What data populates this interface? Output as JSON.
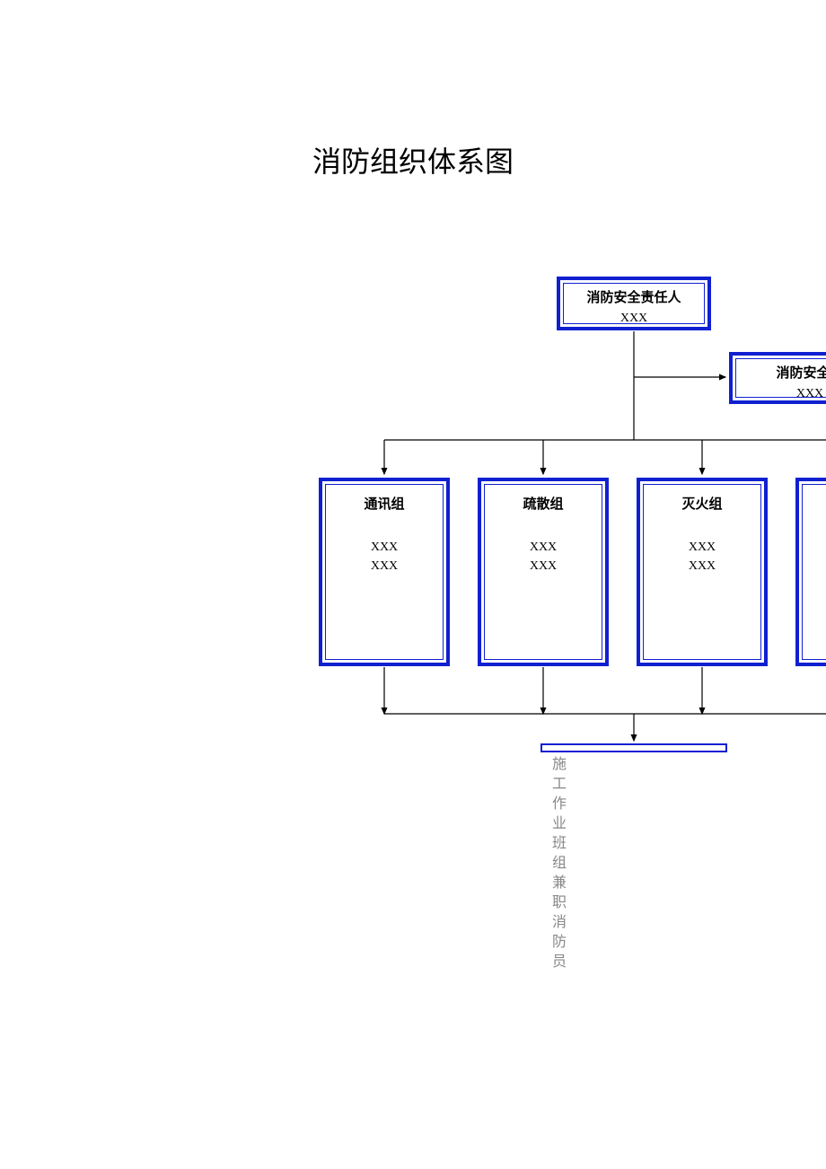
{
  "title": "消防组织体系图",
  "top_box": {
    "label": "消防安全责任人",
    "name": "XXX"
  },
  "manager_box": {
    "label": "消防安全管",
    "name": "XXX"
  },
  "groups": [
    {
      "title": "通讯组",
      "line1": "XXX",
      "line2": "XXX"
    },
    {
      "title": "疏散组",
      "line1": "XXX",
      "line2": "XXX"
    },
    {
      "title": "灭火组",
      "line1": "XXX",
      "line2": "XXX"
    }
  ],
  "bottom_text": "施工作业班组兼职消防员",
  "diagram": {
    "type": "org-chart",
    "description": "Fire protection organization hierarchy",
    "root": "消防安全责任人 XXX",
    "manager_branch": "消防安全管 XXX",
    "teams": [
      "通讯组",
      "疏散组",
      "灭火组"
    ],
    "team_members_placeholder": "XXX XXX",
    "leaf": "施工作业班组兼职消防员"
  }
}
